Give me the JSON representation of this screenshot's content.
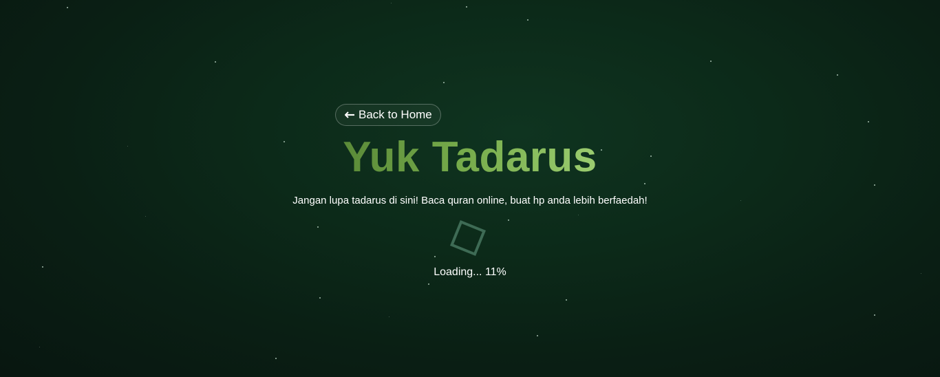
{
  "header": {
    "back_label": "Back to Home",
    "back_icon": "arrow-left-icon"
  },
  "hero": {
    "title": "Yuk Tadarus",
    "subtitle": "Jangan lupa tadarus di sini! Baca quran online, buat hp anda lebih berfaedah!"
  },
  "loader": {
    "icon": "loading-square-icon",
    "label": "Loading... 11%",
    "progress_percent": 11
  },
  "colors": {
    "background": "#0c2a19",
    "title_gradient_start": "#5a8a38",
    "title_gradient_end": "#9ccd70",
    "loader": "#3e6b55"
  }
}
